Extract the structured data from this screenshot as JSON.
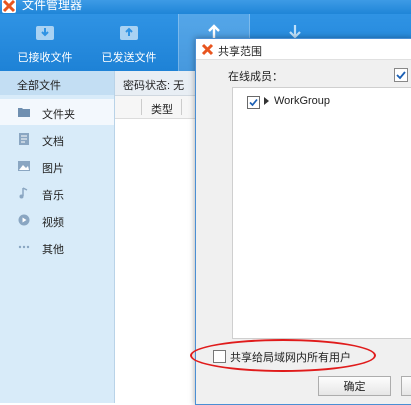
{
  "app": {
    "title": "文件管理器"
  },
  "toolbar": {
    "received_label": "已接收文件",
    "sent_label": "已发送文件"
  },
  "sidebar": {
    "header": "全部文件",
    "items": [
      {
        "label": "文件夹",
        "icon": "folder-icon",
        "active": true
      },
      {
        "label": "文档",
        "icon": "document-icon",
        "active": false
      },
      {
        "label": "图片",
        "icon": "image-icon",
        "active": false
      },
      {
        "label": "音乐",
        "icon": "music-icon",
        "active": false
      },
      {
        "label": "视频",
        "icon": "video-icon",
        "active": false
      },
      {
        "label": "其他",
        "icon": "more-icon",
        "active": false
      }
    ]
  },
  "content": {
    "password_status": "密码状态: 无",
    "column_type": "类型"
  },
  "dialog": {
    "title": "共享范围",
    "members_label": "在线成员：",
    "workgroup_label": "WorkGroup",
    "workgroup_checked": true,
    "select_all_checked": true,
    "share_all_label": "共享给局域网内所有用户",
    "share_all_checked": false,
    "ok_label": "确定"
  },
  "colors": {
    "toolbar": "#2f93e4",
    "sidebar": "#d8ebf9",
    "annotation": "#e01b1b"
  }
}
